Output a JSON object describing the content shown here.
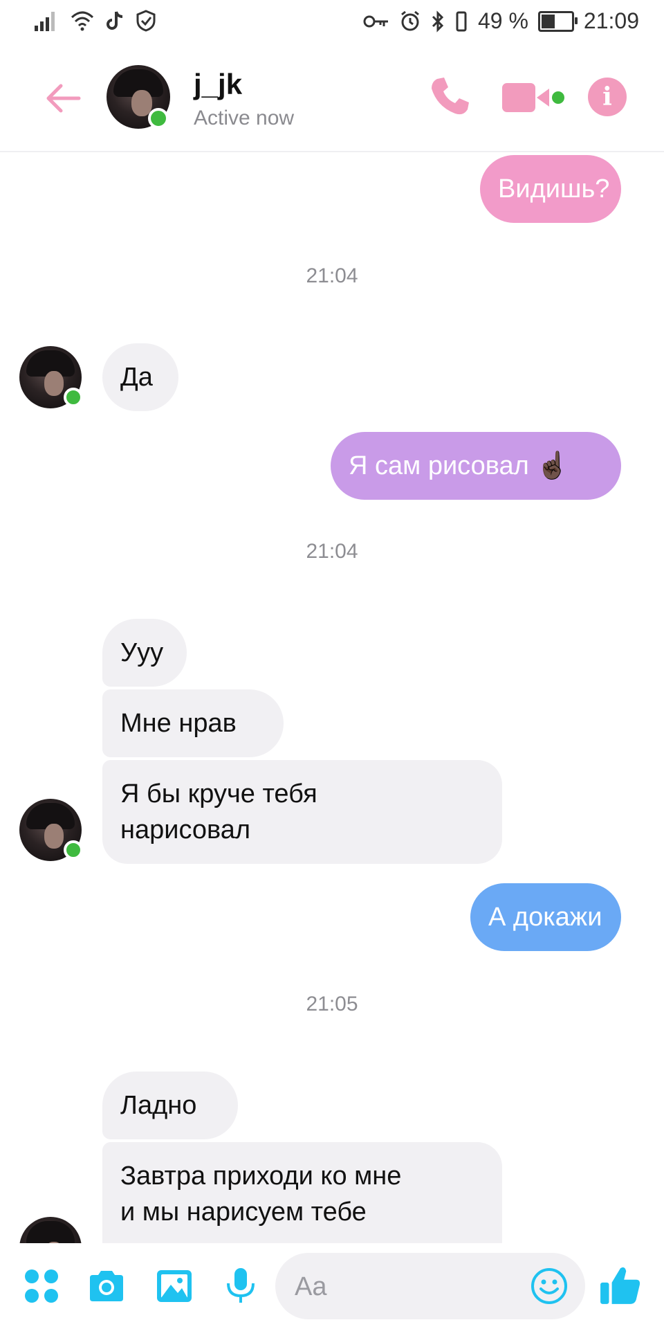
{
  "status_bar": {
    "battery_percent": "49 %",
    "battery_level": 0.49,
    "time": "21:09"
  },
  "header": {
    "contact_name": "j_jk",
    "contact_status": "Active now",
    "accent_color": "#f29bbd",
    "icons": [
      "back-arrow-icon",
      "phone-icon",
      "video-camera-icon",
      "info-icon"
    ]
  },
  "messages": [
    {
      "side": "out",
      "text": "Видишь?",
      "color": "#f29bc9"
    },
    {
      "side": "time",
      "text": "21:04"
    },
    {
      "side": "in",
      "text": "Да"
    },
    {
      "side": "out",
      "text": "Я сам рисовал ☝🏿",
      "color": "#c99be8"
    },
    {
      "side": "time",
      "text": "21:04"
    },
    {
      "side": "in",
      "text": "Ууу"
    },
    {
      "side": "in",
      "text": "Мне нрав"
    },
    {
      "side": "in",
      "text": "Я бы круче тебя\nнарисовал"
    },
    {
      "side": "out",
      "text": "А докажи",
      "color": "#6aa9f5"
    },
    {
      "side": "time",
      "text": "21:05"
    },
    {
      "side": "in",
      "text": "Ладно"
    },
    {
      "side": "in",
      "text": "Завтра приходи ко мне\nи мы нарисуем тебе"
    }
  ],
  "composer": {
    "placeholder": "Aa",
    "icons": [
      "apps-grid-icon",
      "camera-icon",
      "gallery-image-icon",
      "microphone-icon",
      "emoji-icon",
      "thumbs-up-icon"
    ],
    "icon_color": "#1fc2f0"
  }
}
